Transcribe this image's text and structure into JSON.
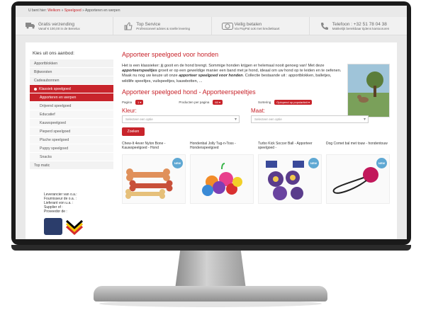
{
  "breadcrumb": {
    "prefix": "U bent hier:",
    "items": [
      "Welkom",
      "Speelgoed",
      "Apporteren en werpen"
    ]
  },
  "usps": [
    {
      "icon": "truck-icon",
      "title": "Gratis verzending",
      "text": "Vanaf € 100,00 in de Benelux"
    },
    {
      "icon": "thumbs-up-icon",
      "title": "Top Service",
      "text": "Professioneel advies & snelle levering"
    },
    {
      "icon": "money-icon",
      "title": "Veilig betalen",
      "text": "Via PayPal ook met kredietkaart"
    },
    {
      "icon": "phone-icon",
      "title": "Telefoon : +32 51 78 04 38",
      "text": "Makkelijk bereikbaar tijdens kantooruren"
    }
  ],
  "sidebar": {
    "title": "Kies uit ons aanbod:",
    "items": [
      {
        "label": "Apportblokken",
        "type": "item"
      },
      {
        "label": "Bijtworsten",
        "type": "item"
      },
      {
        "label": "Cadeaubonnen",
        "type": "item"
      },
      {
        "label": "Klassiek speelgoed",
        "type": "active"
      },
      {
        "label": "Apporteren en werpen",
        "type": "active-sub"
      },
      {
        "label": "Drijvend speelgoed",
        "type": "sub"
      },
      {
        "label": "Educatief",
        "type": "sub"
      },
      {
        "label": "Kauwspeelgoed",
        "type": "sub"
      },
      {
        "label": "Pieperd speelgoed",
        "type": "sub"
      },
      {
        "label": "Pluche speelgoed",
        "type": "sub"
      },
      {
        "label": "Puppy speelgoed",
        "type": "sub"
      },
      {
        "label": "Snacks",
        "type": "sub"
      },
      {
        "label": "Top matic",
        "type": "item"
      }
    ]
  },
  "supplier": {
    "lines": [
      "Leverancier van o.a.:",
      "Fournisseur de o.a. :",
      "Lieferant von u.a. :",
      "Supplier of :",
      "Proveedor de :"
    ]
  },
  "main": {
    "title": "Apporteer speelgoed voor honden",
    "intro_parts": [
      "Het is een klassieker: jij gooit en de hond brengt. Sommige honden krijgen er helemaal nooit genoeg van! Met deze ",
      "apporteerspeeltjes",
      " groeit er op een geweldige manier een band met je hond, ideaal om uw hond op te leiden en te oefenen. Maak nu nog uw keuze uit onze ",
      "apporteer speelgoed voor honden",
      ". Collectie bestaande uit : apportblokken, balletjes, wildlife speeltjes, vuilspeeltjes, kauwbotten, ..."
    ],
    "subtitle": "Apporteer speelgoed hond - Apporteerspeeltjes",
    "sort": {
      "page_label": "Pagina",
      "page_value": "1",
      "per_page_label": "Producten per pagina",
      "per_page_value": "60",
      "sort_label": "Sortering",
      "sort_value": "Oplopend op populariteit"
    },
    "filters": {
      "color_label": "Kleur:",
      "color_placeholder": "Selecteer een optie",
      "size_label": "Maat:",
      "size_placeholder": "Selecteer een optie",
      "button": "Zoeken"
    },
    "products": [
      {
        "name": "Chew-It 4ever Nylon Bone - Kauwspeelgoed - Hond",
        "badge": "NEW"
      },
      {
        "name": "Hondenbal Jolly Tug-n-Toss - Hondenspeelgoed",
        "badge": ""
      },
      {
        "name": "Turbo Kick Soccer Ball - Apporteer speelgoed -",
        "badge": "NEW"
      },
      {
        "name": "Dog Comet bal met touw - hondentouw",
        "badge": "NEW"
      }
    ]
  },
  "colors": {
    "accent": "#c8242b"
  }
}
